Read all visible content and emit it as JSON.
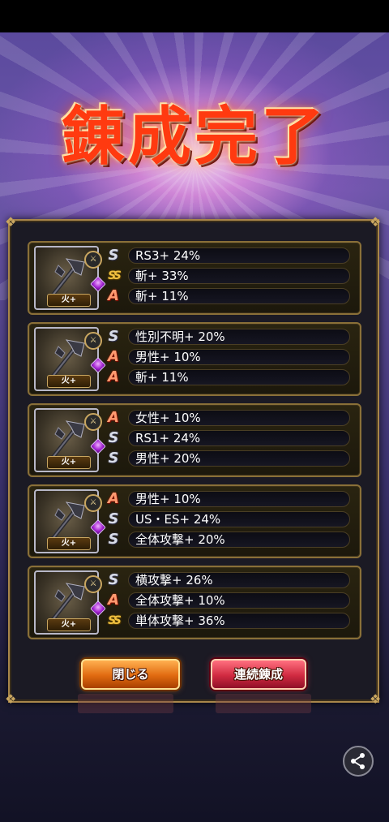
{
  "title": "錬成完了",
  "cards": [
    {
      "element_label": "火+",
      "abilities": [
        {
          "rank": "S",
          "text": "RS3+ 24%"
        },
        {
          "rank": "SS",
          "text": "斬+ 33%"
        },
        {
          "rank": "A",
          "text": "斬+ 11%"
        }
      ]
    },
    {
      "element_label": "火+",
      "abilities": [
        {
          "rank": "S",
          "text": "性別不明+ 20%"
        },
        {
          "rank": "A",
          "text": "男性+ 10%"
        },
        {
          "rank": "A",
          "text": "斬+ 11%"
        }
      ]
    },
    {
      "element_label": "火+",
      "abilities": [
        {
          "rank": "A",
          "text": "女性+ 10%"
        },
        {
          "rank": "S",
          "text": "RS1+ 24%"
        },
        {
          "rank": "S",
          "text": "男性+ 20%"
        }
      ]
    },
    {
      "element_label": "火+",
      "abilities": [
        {
          "rank": "A",
          "text": "男性+ 10%"
        },
        {
          "rank": "S",
          "text": "US・ES+ 24%"
        },
        {
          "rank": "S",
          "text": "全体攻撃+ 20%"
        }
      ]
    },
    {
      "element_label": "火+",
      "abilities": [
        {
          "rank": "S",
          "text": "横攻撃+ 26%"
        },
        {
          "rank": "A",
          "text": "全体攻撃+ 10%"
        },
        {
          "rank": "SS",
          "text": "単体攻撃+ 36%"
        }
      ]
    }
  ],
  "buttons": {
    "close": "閉じる",
    "continuous": "連続錬成"
  },
  "icons": {
    "weapon": "axe-icon",
    "share": "share-icon"
  }
}
